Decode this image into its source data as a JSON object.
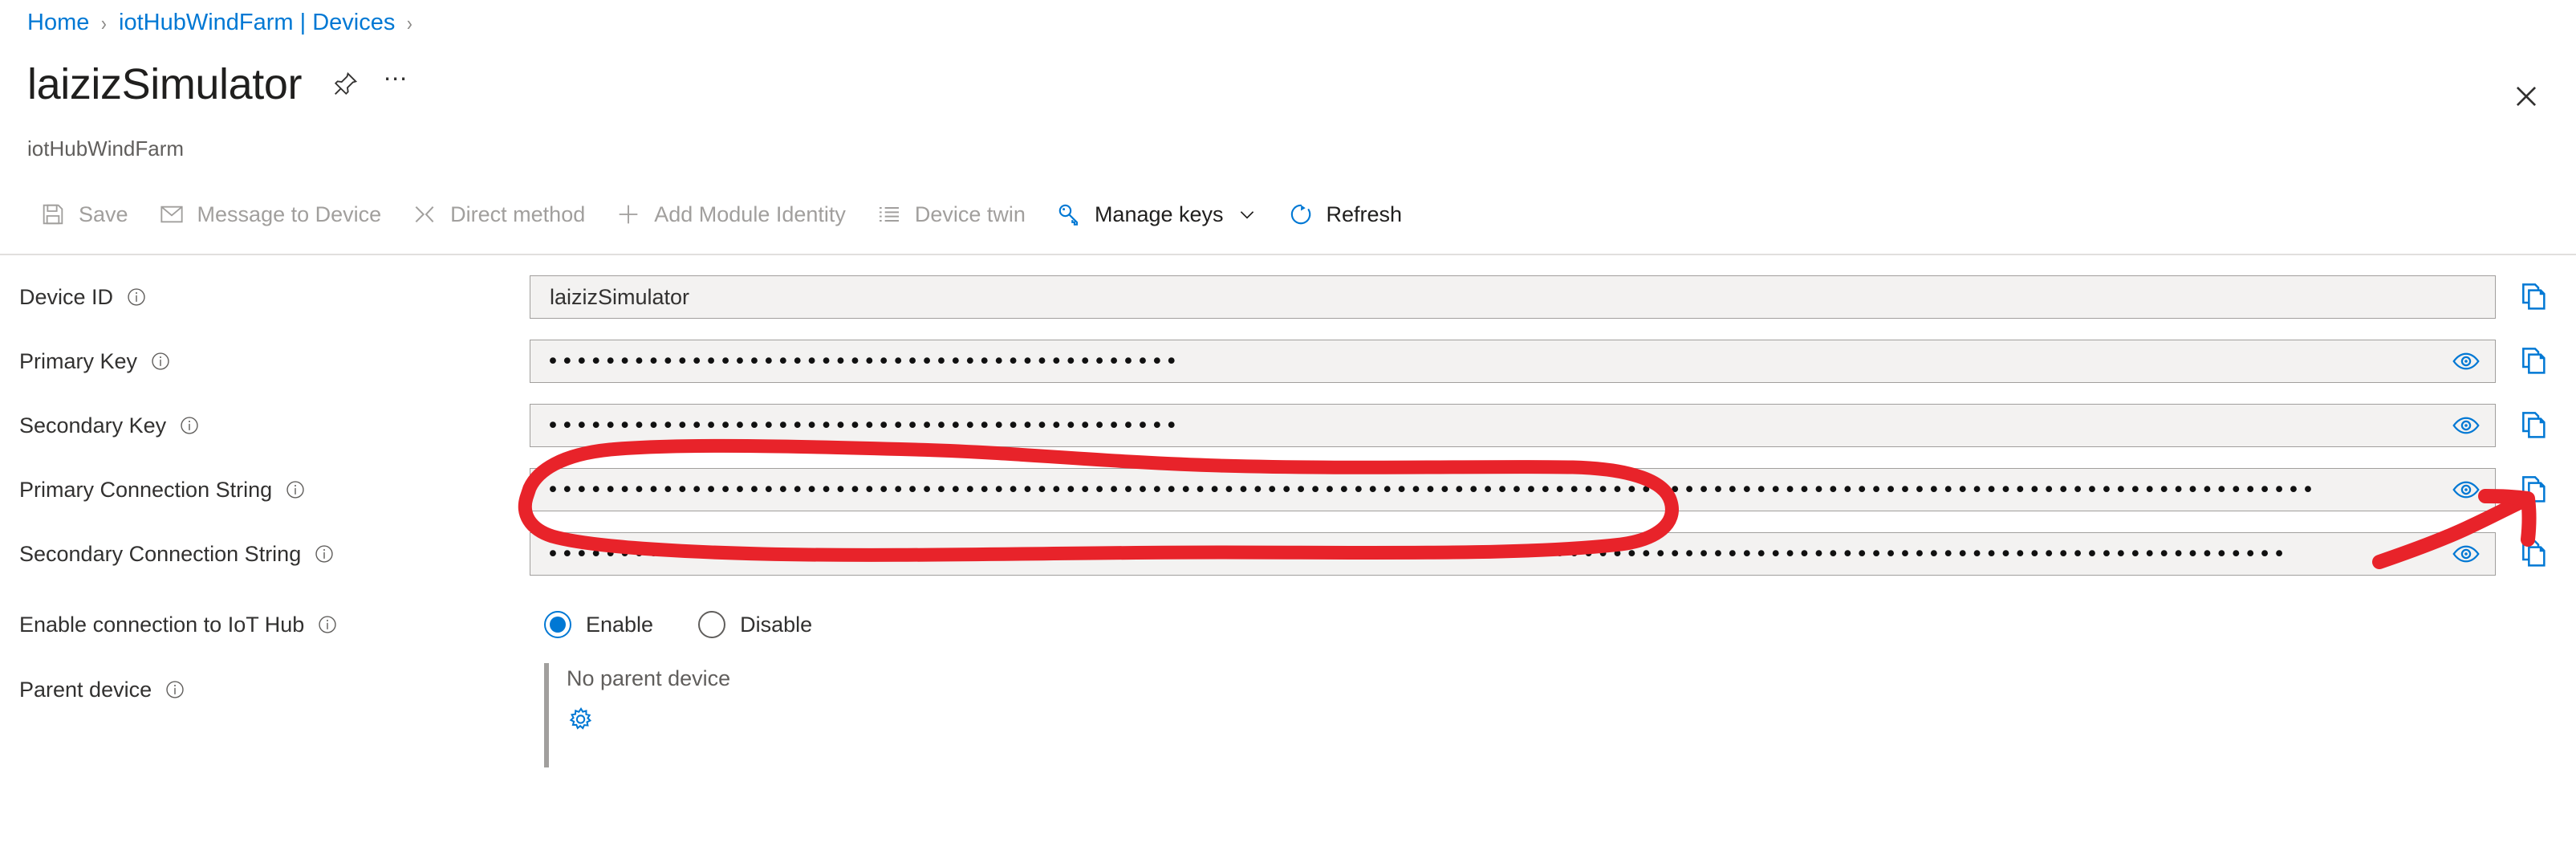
{
  "breadcrumb": {
    "items": [
      {
        "label": "Home"
      },
      {
        "label": "iotHubWindFarm | Devices"
      }
    ],
    "separator": "›"
  },
  "header": {
    "title": "laizizSimulator",
    "subtitle": "iotHubWindFarm",
    "pin_icon": "pin-icon",
    "more_icon": "ellipsis-icon",
    "close_icon": "close-icon"
  },
  "toolbar": {
    "items": [
      {
        "label": "Save",
        "icon": "save-icon",
        "enabled": false
      },
      {
        "label": "Message to Device",
        "icon": "envelope-icon",
        "enabled": false
      },
      {
        "label": "Direct method",
        "icon": "direct-method-icon",
        "enabled": false
      },
      {
        "label": "Add Module Identity",
        "icon": "plus-icon",
        "enabled": false
      },
      {
        "label": "Device twin",
        "icon": "list-icon",
        "enabled": false
      },
      {
        "label": "Manage keys",
        "icon": "key-icon",
        "enabled": true,
        "caret": true
      },
      {
        "label": "Refresh",
        "icon": "refresh-icon",
        "enabled": true
      }
    ]
  },
  "form": {
    "fields": [
      {
        "label": "Device ID",
        "value": "laizizSimulator",
        "masked": false,
        "has_eye": false,
        "has_copy": true
      },
      {
        "label": "Primary Key",
        "value": "••••••••••••••••••••••••••••••••••••••••••••",
        "masked": true,
        "has_eye": true,
        "has_copy": true
      },
      {
        "label": "Secondary Key",
        "value": "••••••••••••••••••••••••••••••••••••••••••••",
        "masked": true,
        "has_eye": true,
        "has_copy": true
      },
      {
        "label": "Primary Connection String",
        "value": "•••••••••••••••••••••••••••••••••••••••••••••••••••••••••••••••••••••••••••••••••••••••••••••••••••••••••••••••••••••••••••",
        "masked": true,
        "has_eye": true,
        "has_copy": true,
        "annotated": true
      },
      {
        "label": "Secondary Connection String",
        "value": "•••••••••••••••••••••••••••••••••••••••••••••••••••••••••••••••••••••••••••••••••••••••••••••••••••••••••••••••••••••••••",
        "masked": true,
        "has_eye": true,
        "has_copy": true
      }
    ],
    "connection": {
      "label": "Enable connection to IoT Hub",
      "options": [
        {
          "label": "Enable",
          "selected": true
        },
        {
          "label": "Disable",
          "selected": false
        }
      ]
    },
    "parent_device": {
      "label": "Parent device",
      "value": "No parent device",
      "gear_icon": "gear-icon"
    }
  },
  "annotation": {
    "type": "red-ink-markup",
    "color": "#e8232a",
    "circle_target": "Primary Connection String",
    "arrow_target": "Primary Connection String copy button"
  },
  "colors": {
    "accent": "#0078d4",
    "link": "#0078d4",
    "text": "#201f1e",
    "muted": "#605e5c",
    "disabled": "#a19f9d",
    "field_bg": "#f3f2f1",
    "field_border": "#a19f9d",
    "annotation": "#e8232a"
  }
}
